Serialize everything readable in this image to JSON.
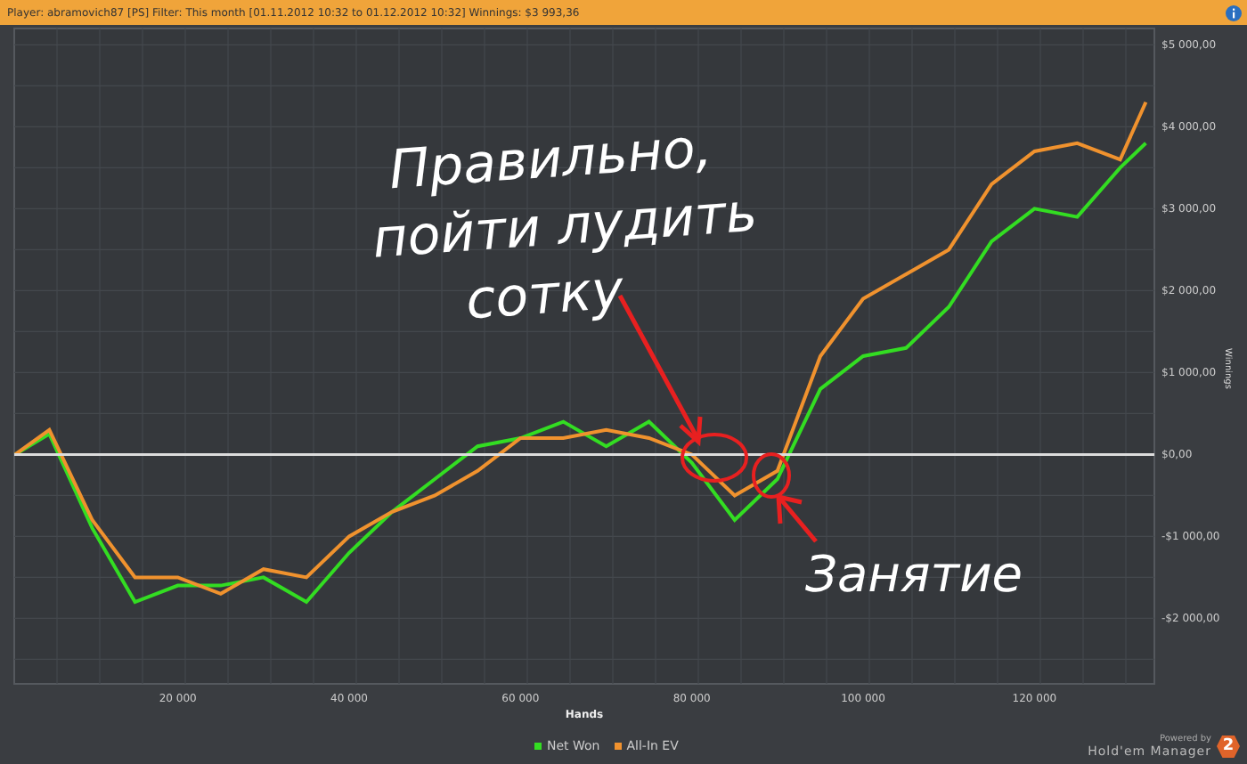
{
  "header": {
    "text": "Player: abramovich87 [PS] Filter: This month [01.11.2012 10:32 to 01.12.2012 10:32] Winnings: $3 993,36"
  },
  "chart": {
    "chart_data": {
      "type": "line",
      "xlabel": "Hands",
      "ylabel": "Winnings",
      "grid": true,
      "x": [
        1000,
        5000,
        10000,
        15000,
        20000,
        25000,
        30000,
        35000,
        40000,
        45000,
        50000,
        55000,
        60000,
        65000,
        70000,
        75000,
        80000,
        85000,
        90000,
        95000,
        100000,
        105000,
        110000,
        115000,
        120000,
        125000,
        130000,
        133000
      ],
      "series": [
        {
          "name": "Net Won",
          "color": "#33dd22",
          "values": [
            0,
            250,
            -900,
            -1800,
            -1600,
            -1600,
            -1500,
            -1800,
            -1200,
            -700,
            -300,
            100,
            200,
            400,
            100,
            400,
            -100,
            -800,
            -300,
            800,
            1200,
            1300,
            1800,
            2600,
            3000,
            2900,
            3500,
            3800
          ]
        },
        {
          "name": "All-In EV",
          "color": "#f0922e",
          "values": [
            0,
            300,
            -800,
            -1500,
            -1500,
            -1700,
            -1400,
            -1500,
            -1000,
            -700,
            -500,
            -200,
            200,
            200,
            300,
            200,
            0,
            -500,
            -200,
            1200,
            1900,
            2200,
            2500,
            3300,
            3700,
            3800,
            3600,
            4300
          ]
        }
      ],
      "xlim": [
        900,
        134000
      ],
      "ylim": [
        -2800,
        5200
      ],
      "xticks": [
        {
          "value": 20000,
          "label": "20 000"
        },
        {
          "value": 40000,
          "label": "40 000"
        },
        {
          "value": 60000,
          "label": "60 000"
        },
        {
          "value": 80000,
          "label": "80 000"
        },
        {
          "value": 100000,
          "label": "100 000"
        },
        {
          "value": 120000,
          "label": "120 000"
        }
      ],
      "yticks": [
        {
          "value": 5000,
          "label": "$5 000,00"
        },
        {
          "value": 4000,
          "label": "$4 000,00"
        },
        {
          "value": 3000,
          "label": "$3 000,00"
        },
        {
          "value": 2000,
          "label": "$2 000,00"
        },
        {
          "value": 1000,
          "label": "$1 000,00"
        },
        {
          "value": 0,
          "label": "$0,00"
        },
        {
          "value": -1000,
          "label": "-$1 000,00"
        },
        {
          "value": -2000,
          "label": "-$2 000,00"
        }
      ],
      "annotations": [
        {
          "text": "Правильно,\nпойти лудить\nсотку"
        },
        {
          "text": "Занятие"
        }
      ]
    }
  },
  "brand": {
    "powered_by": "Powered by",
    "name": "Hold'em Manager",
    "badge": "2"
  }
}
